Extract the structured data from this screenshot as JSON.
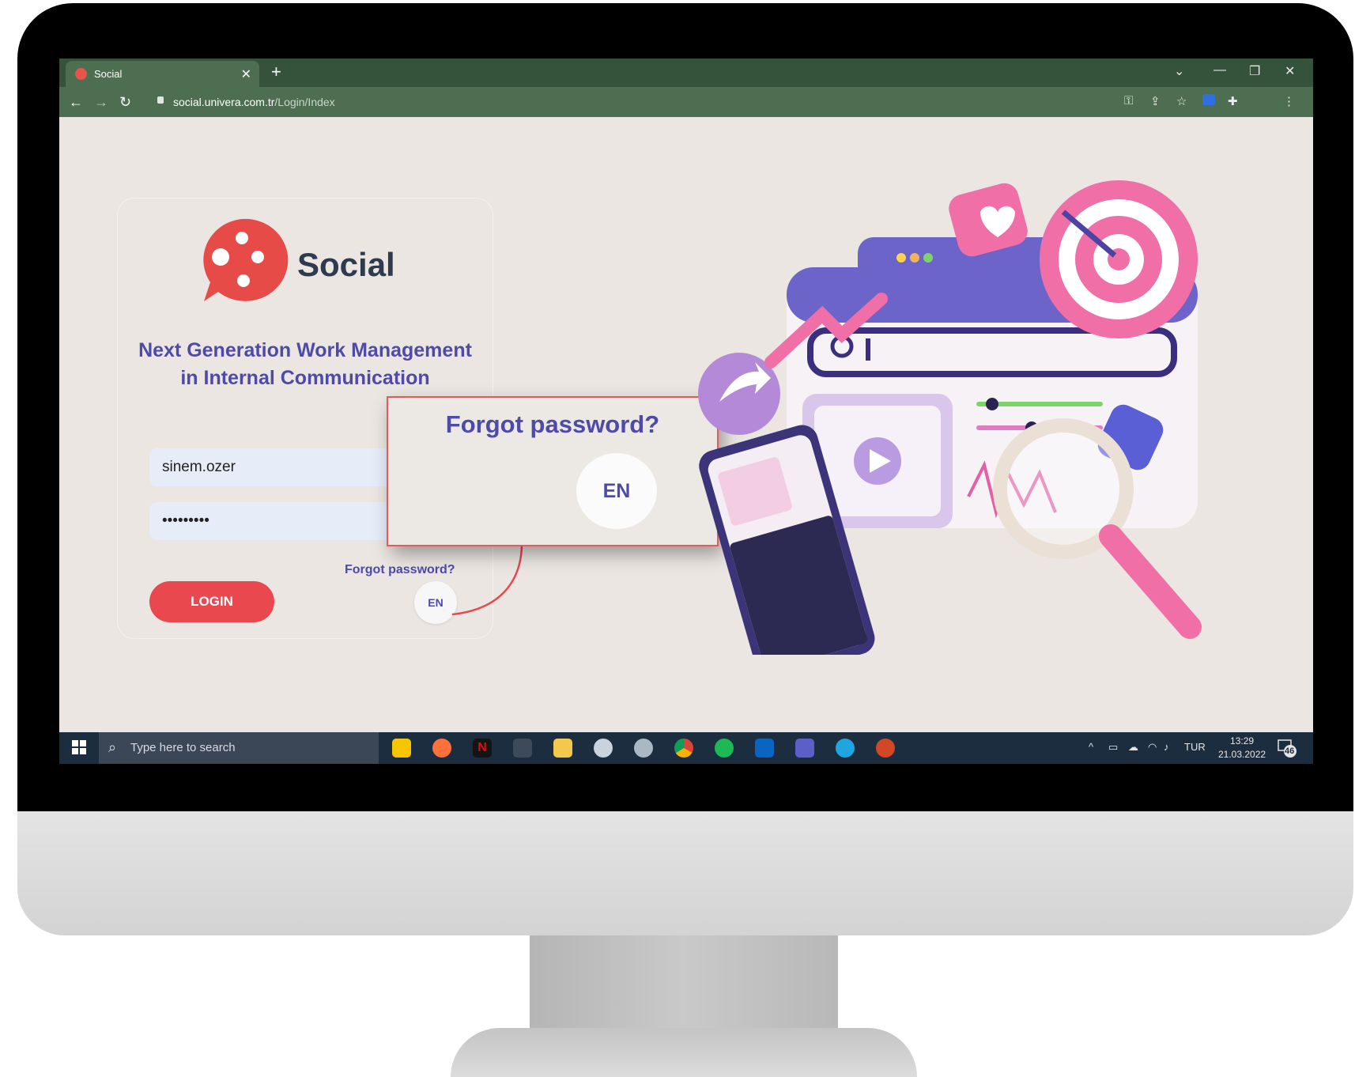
{
  "browser": {
    "tab_title": "Social",
    "url_domain": "social.univera.com.tr",
    "url_path": "/Login/Index"
  },
  "login": {
    "brand": "Social",
    "tagline": "Next Generation Work Management in Internal Communication",
    "username_value": "sinem.ozer",
    "password_value": "•••••••••",
    "forgot_label": "Forgot password?",
    "login_label": "LOGIN",
    "language": "EN"
  },
  "callout": {
    "forgot_label": "Forgot password?",
    "language": "EN"
  },
  "taskbar": {
    "search_placeholder": "Type here to search",
    "language": "TUR",
    "time": "13:29",
    "date": "21.03.2022",
    "notification_count": "46",
    "apps": [
      "sticky-notes-icon",
      "firefox-icon",
      "netflix-icon",
      "snipping-icon",
      "file-explorer-icon",
      "paint-icon",
      "app-icon",
      "chrome-icon",
      "spotify-icon",
      "outlook-icon",
      "teams-icon",
      "edge-icon",
      "powerpoint-icon"
    ]
  },
  "colors": {
    "accent": "#e8484e",
    "brand_text": "#4d4aa8",
    "browser_frame": "#4d6e50",
    "page_bg": "#ebe6e2",
    "taskbar": "#1d2d40"
  }
}
